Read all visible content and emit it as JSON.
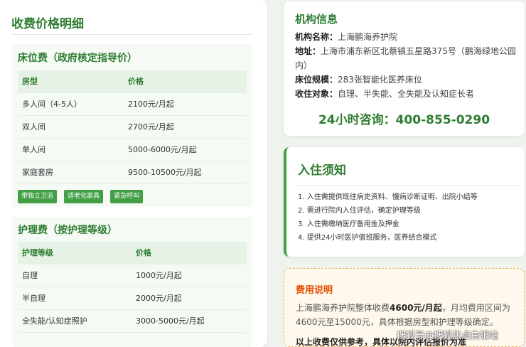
{
  "page_title": "收费价格明细",
  "bed_fee": {
    "title": "床位费（政府核定指导价）",
    "headers": [
      "房型",
      "价格"
    ],
    "rows": [
      [
        "多人间（4-5人）",
        "2100元/月起"
      ],
      [
        "双人间",
        "2700元/月起"
      ],
      [
        "单人间",
        "5000-6000元/月起"
      ],
      [
        "家庭套房",
        "9500-10500元/月起"
      ]
    ],
    "tags": [
      "带独立卫浴",
      "适老化家具",
      "紧急呼叫"
    ]
  },
  "nursing_fee": {
    "title": "护理费（按护理等级）",
    "headers": [
      "护理等级",
      "价格"
    ],
    "rows": [
      [
        "自理",
        "1000元/月起"
      ],
      [
        "半自理",
        "2000元/月起"
      ],
      [
        "全失能/认知症照护",
        "3000-5000元/月起"
      ]
    ]
  },
  "org_info": {
    "title": "机构信息",
    "name_label": "机构名称：",
    "name_value": "上海鹏海养护院",
    "address_label": "地址：",
    "address_value": "上海市浦东新区北蔡镇五星路375号（鹏海绿地公园内）",
    "scale_label": "床位规模：",
    "scale_value": "283张智能化医养床位",
    "target_label": "收住对象：",
    "target_value": "自理、半失能、全失能及认知症长者",
    "hotline": "24小时咨询：400-855-0290"
  },
  "admission": {
    "title": "入住须知",
    "items": [
      "1. 入住需提供既往病史资料、慢病诊断证明、出院小结等",
      "2. 需进行院内入住评估，确定护理等级",
      "3. 入住需缴纳医疗备用金及押金",
      "4. 提供24小时医护值班服务，医养结合模式"
    ]
  },
  "fee_note": {
    "title": "费用说明",
    "line1_prefix": "上海鹏海养护院整体收费",
    "line1_bold": "4600元/月起",
    "line1_suffix": "，月均费用区间为",
    "line2": "4600元至15000元，具体根据房型和护理等级确定。",
    "line3": "以上收费仅供参考，具体以院内评估报价为准"
  },
  "watermark": "搜狐号@搜狐焦点白银站",
  "colors": {
    "primary_green": "#2e7d32",
    "tag_green": "#43a047",
    "fee_orange": "#e65100",
    "fee_bg": "#fff8ec"
  }
}
